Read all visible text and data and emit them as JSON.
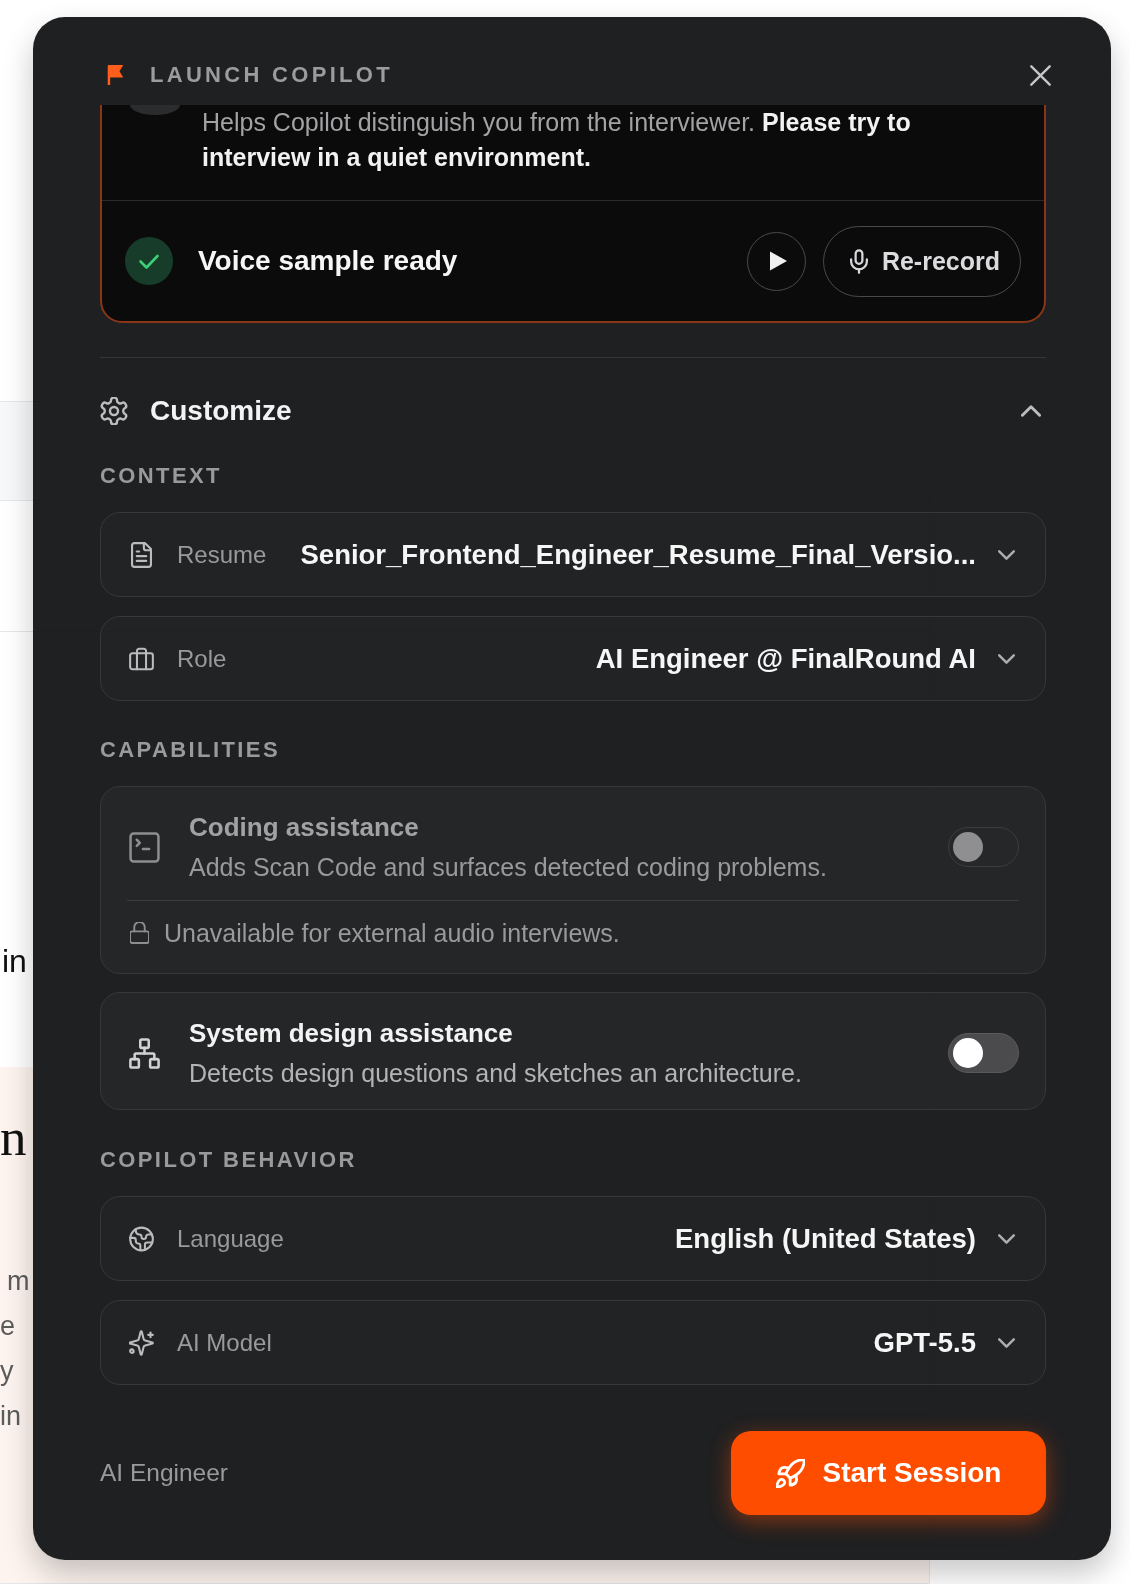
{
  "page": {
    "side_text": "in",
    "feedback": {
      "heading": "n",
      "lines": [
        "m",
        "e",
        "y",
        "in"
      ]
    }
  },
  "dialog": {
    "title": "LAUNCH COPILOT",
    "voice_sample": {
      "description": "Helps Copilot distinguish you from the interviewer. **Please try to interview in a quiet environment.**",
      "status": "Voice sample ready",
      "rerecord_button": "Re-record"
    },
    "customize": {
      "title": "Customize",
      "expanded": true
    },
    "context": {
      "heading": "CONTEXT",
      "selects": [
        {
          "label": "Resume",
          "value": "Senior_Frontend_Engineer_Resume_Final_Versio..."
        },
        {
          "label": "Role",
          "value": "AI Engineer @ FinalRound AI"
        }
      ]
    },
    "capabilities": {
      "heading": "CAPABILITIES",
      "items": [
        {
          "title": "Coding assistance",
          "description": "Adds Scan Code and surfaces detected coding problems.",
          "note": "Unavailable for external audio interviews.",
          "on": false,
          "disabled": true
        },
        {
          "title": "System design assistance",
          "description": "Detects design questions and sketches an architecture.",
          "on": false,
          "disabled": false
        }
      ]
    },
    "behavior": {
      "heading": "COPILOT BEHAVIOR",
      "selects": [
        {
          "label": "Language",
          "value": "English (United States)"
        },
        {
          "label": "AI Model",
          "value": "GPT-5.5"
        }
      ]
    },
    "footer": {
      "role": "AI Engineer",
      "start_button": "Start Session"
    }
  }
}
